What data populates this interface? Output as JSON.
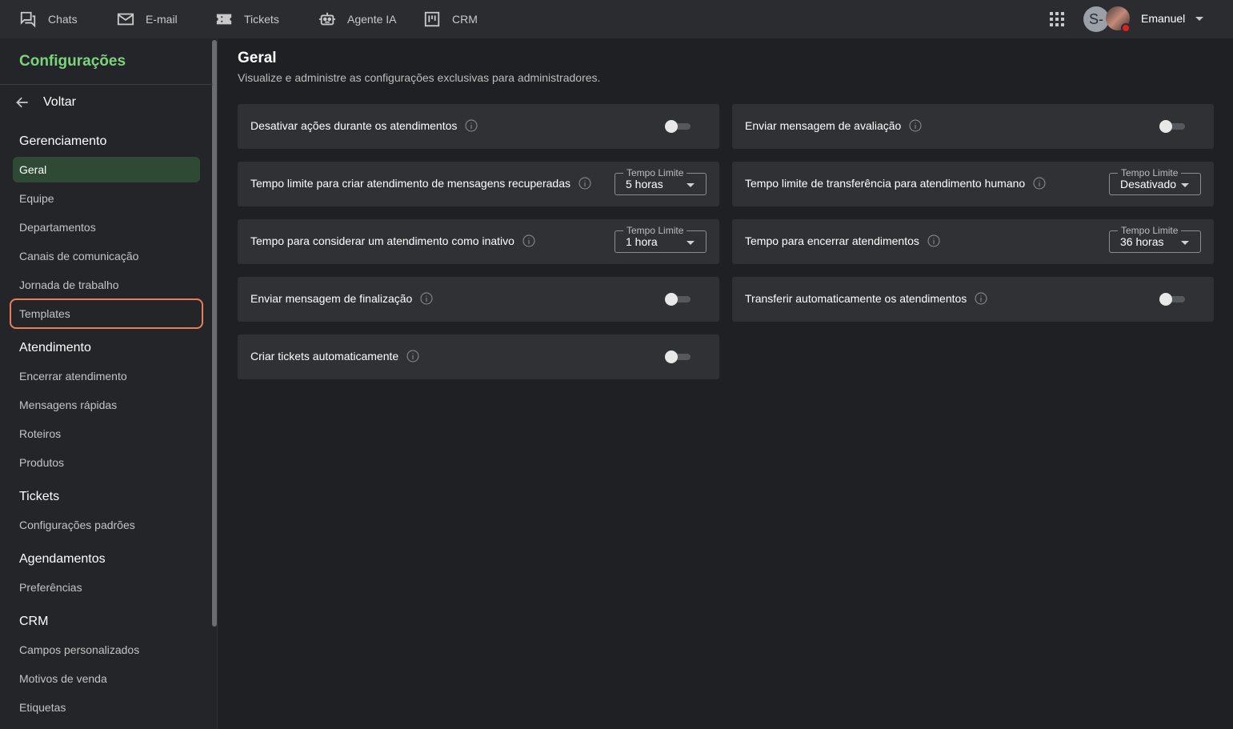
{
  "topnav": {
    "items": [
      {
        "label": "Chats",
        "icon": "chat-icon"
      },
      {
        "label": "E-mail",
        "icon": "mail-icon"
      },
      {
        "label": "Tickets",
        "icon": "ticket-icon"
      },
      {
        "label": "Agente IA",
        "icon": "robot-icon"
      },
      {
        "label": "CRM",
        "icon": "kanban-icon"
      }
    ],
    "avatar_initial": "S-",
    "user_name": "Emanuel"
  },
  "sidebar": {
    "title": "Configurações",
    "back_label": "Voltar",
    "sections": [
      {
        "title": "Gerenciamento",
        "items": [
          "Geral",
          "Equipe",
          "Departamentos",
          "Canais de comunicação",
          "Jornada de trabalho",
          "Templates"
        ]
      },
      {
        "title": "Atendimento",
        "items": [
          "Encerrar atendimento",
          "Mensagens rápidas",
          "Roteiros",
          "Produtos"
        ]
      },
      {
        "title": "Tickets",
        "items": [
          "Configurações padrões"
        ]
      },
      {
        "title": "Agendamentos",
        "items": [
          "Preferências"
        ]
      },
      {
        "title": "CRM",
        "items": [
          "Campos personalizados",
          "Motivos de venda",
          "Etiquetas"
        ]
      }
    ],
    "active_item": "Geral",
    "highlighted_item": "Templates"
  },
  "main": {
    "title": "Geral",
    "subtitle": "Visualize e administre as configurações exclusivas para administradores.",
    "settings": [
      {
        "label": "Desativar ações durante os atendimentos",
        "type": "toggle",
        "on": false
      },
      {
        "label": "Enviar mensagem de avaliação",
        "type": "toggle",
        "on": false
      },
      {
        "label": "Tempo limite para criar atendimento de mensagens recuperadas",
        "type": "select",
        "legend": "Tempo Limite",
        "value": "5 horas"
      },
      {
        "label": "Tempo limite de transferência para atendimento humano",
        "type": "select",
        "legend": "Tempo Limite",
        "value": "Desativado"
      },
      {
        "label": "Tempo para considerar um atendimento como inativo",
        "type": "select",
        "legend": "Tempo Limite",
        "value": "1 hora"
      },
      {
        "label": "Tempo para encerrar atendimentos",
        "type": "select",
        "legend": "Tempo Limite",
        "value": "36 horas"
      },
      {
        "label": "Enviar mensagem de finalização",
        "type": "toggle",
        "on": false
      },
      {
        "label": "Transferir automaticamente os atendimentos",
        "type": "toggle",
        "on": false
      },
      {
        "label": "Criar tickets automaticamente",
        "type": "toggle",
        "on": false
      }
    ]
  },
  "colors": {
    "accent": "#7bd47c",
    "active_bg": "#2f4a34",
    "highlight_border": "#ee7c5a",
    "status_busy": "#e0201b"
  }
}
